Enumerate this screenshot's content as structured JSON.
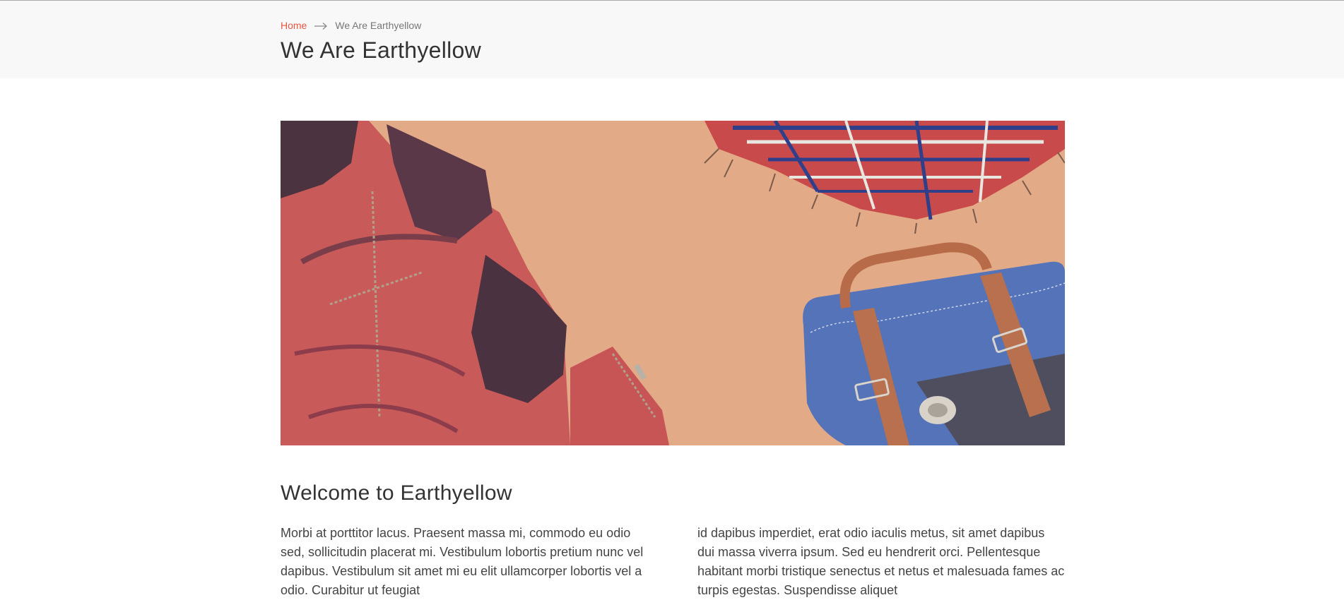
{
  "breadcrumb": {
    "home_label": "Home",
    "current_label": "We Are Earthyellow",
    "separator_icon": "arrow-right-icon"
  },
  "header": {
    "title": "We Are Earthyellow"
  },
  "hero": {
    "image_icon": "fashion-flatlay-image"
  },
  "content": {
    "heading": "Welcome to Earthyellow",
    "column_left": "Morbi at porttitor lacus. Praesent massa mi, commodo eu odio sed, sollicitudin placerat mi. Vestibulum lobortis pretium nunc vel dapibus. Vestibulum sit amet mi eu elit ullamcorper lobortis vel a odio. Curabitur ut feugiat",
    "column_right": "id dapibus imperdiet, erat odio iaculis metus, sit amet dapibus dui massa viverra ipsum. Sed eu hendrerit orci. Pellentesque habitant morbi tristique senectus et netus et malesuada fames ac turpis egestas. Suspendisse aliquet"
  },
  "colors": {
    "accent": "#e8563f",
    "header_bg": "#f8f8f8",
    "hero_bg": "#e2aa86"
  }
}
